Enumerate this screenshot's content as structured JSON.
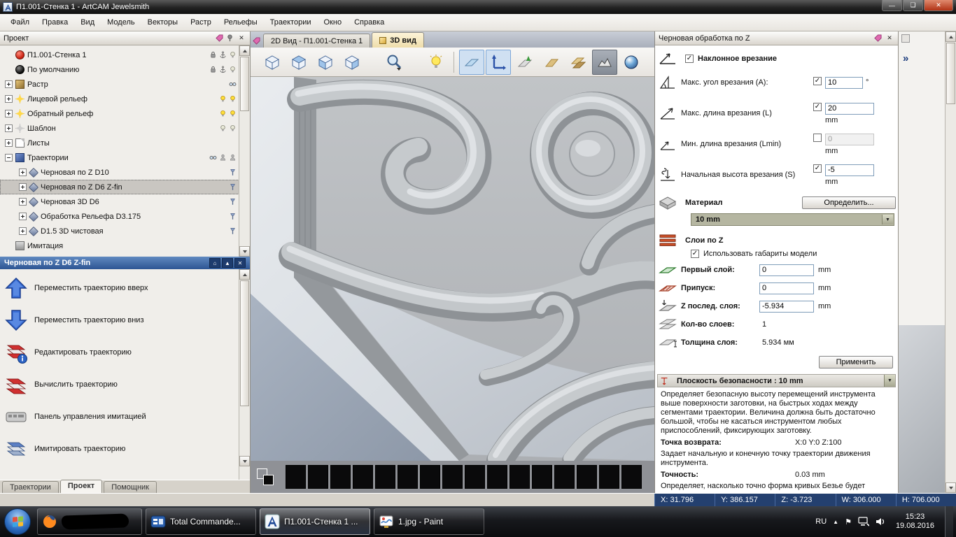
{
  "window": {
    "title": "П1.001-Стенка 1 - ArtCAM Jewelsmith"
  },
  "menu": {
    "items": [
      "Файл",
      "Правка",
      "Вид",
      "Модель",
      "Векторы",
      "Растр",
      "Рельефы",
      "Траектории",
      "Окно",
      "Справка"
    ]
  },
  "project": {
    "title": "Проект",
    "tree": [
      {
        "label": "П1.001-Стенка 1"
      },
      {
        "label": "По умолчанию"
      },
      {
        "label": "Растр"
      },
      {
        "label": "Лицевой рельеф"
      },
      {
        "label": "Обратный рельеф"
      },
      {
        "label": "Шаблон"
      },
      {
        "label": "Листы"
      },
      {
        "label": "Траектории"
      },
      {
        "label": "Черновая по Z D10"
      },
      {
        "label": "Черновая по Z D6 Z-fin"
      },
      {
        "label": "Черновая 3D D6"
      },
      {
        "label": "Обработка Рельефа D3.175"
      },
      {
        "label": "D1.5 3D чистовая"
      },
      {
        "label": "Имитация"
      }
    ],
    "selected_toolpath": "Черновая по Z D6 Z-fin",
    "actions": [
      {
        "label": "Переместить траекторию вверх"
      },
      {
        "label": "Переместить траекторию вниз"
      },
      {
        "label": "Редактировать траекторию"
      },
      {
        "label": "Вычислить траекторию"
      },
      {
        "label": "Панель управления имитацией"
      },
      {
        "label": "Имитировать траекторию"
      }
    ],
    "bottom_tabs": [
      {
        "label": "Траектории"
      },
      {
        "label": "Проект"
      },
      {
        "label": "Помощник"
      }
    ]
  },
  "view": {
    "tabs": [
      {
        "label": "2D Вид - П1.001-Стенка 1"
      },
      {
        "label": "3D вид"
      }
    ]
  },
  "toolpath_panel": {
    "title": "Черновая обработка по Z",
    "ramp": {
      "title": "Наклонное врезание",
      "title_checked": "true",
      "rows": [
        {
          "label": "Макс. угол врезания  (А):",
          "checked": "true",
          "value": "10",
          "unit": "°"
        },
        {
          "label": "Макс. длина врезания (L)",
          "checked": "true",
          "value": "20",
          "unit": "mm"
        },
        {
          "label": "Мин. длина врезания (Lmin)",
          "checked": "false",
          "value": "0",
          "unit": "mm"
        },
        {
          "label": "Начальная высота врезания (S)",
          "checked": "true",
          "value": "-5",
          "unit": "mm"
        }
      ]
    },
    "material": {
      "label": "Материал",
      "define_button": "Определить...",
      "selected": "10 mm"
    },
    "slices": {
      "title": "Слои по Z",
      "use_model_label": "Использовать габариты модели",
      "use_model_checked": "true",
      "first_label": "Первый слой:",
      "first_value": "0",
      "allowance_label": "Припуск:",
      "allowance_value": "0",
      "last_label": "Z послед. слоя:",
      "last_value": "-5.934",
      "count_label": "Кол-во слоев:",
      "count_value": "1",
      "thickness_label": "Толщина слоя:",
      "thickness_value": "5.934 мм",
      "unit": "mm",
      "apply_button": "Применить"
    },
    "safe_z": {
      "header": "Плоскость безопасности : 10 mm",
      "description": "Определяет безопасную высоту перемещений инструмента выше поверхности заготовки, на быстрых ходах между сегментами траектории. Величина должна быть достаточно большой, чтобы не касаться инструментом любых приспособлений, фиксирующих заготовку.",
      "home_label": "Точка возврата:",
      "home_value": "X:0 Y:0 Z:100",
      "home_description": "Задает начальную и конечную точку траектории движения инструмента.",
      "tolerance_label": "Точность:",
      "tolerance_value": "0.03 mm",
      "tolerance_description": "Определяет,  насколько точно форма кривых Безье будет"
    }
  },
  "status": {
    "cells": [
      "X: 31.796",
      "Y: 386.157",
      "Z: -3.723",
      "W: 306.000",
      "H: 706.000"
    ]
  },
  "taskbar": {
    "apps": [
      {
        "label": ""
      },
      {
        "label": "Total Commande..."
      },
      {
        "label": "П1.001-Стенка 1 ..."
      },
      {
        "label": "1.jpg - Paint"
      }
    ],
    "tray": {
      "lang": "RU",
      "time": "15:23",
      "date": "19.08.2016"
    }
  },
  "icons": {
    "close": "✕",
    "minimize": "—",
    "maximize": "❏",
    "dropdown": "▼",
    "chevron": "»",
    "home": "⌂",
    "collapse": "▲",
    "tray_up": "▲",
    "flag": "⚑"
  }
}
